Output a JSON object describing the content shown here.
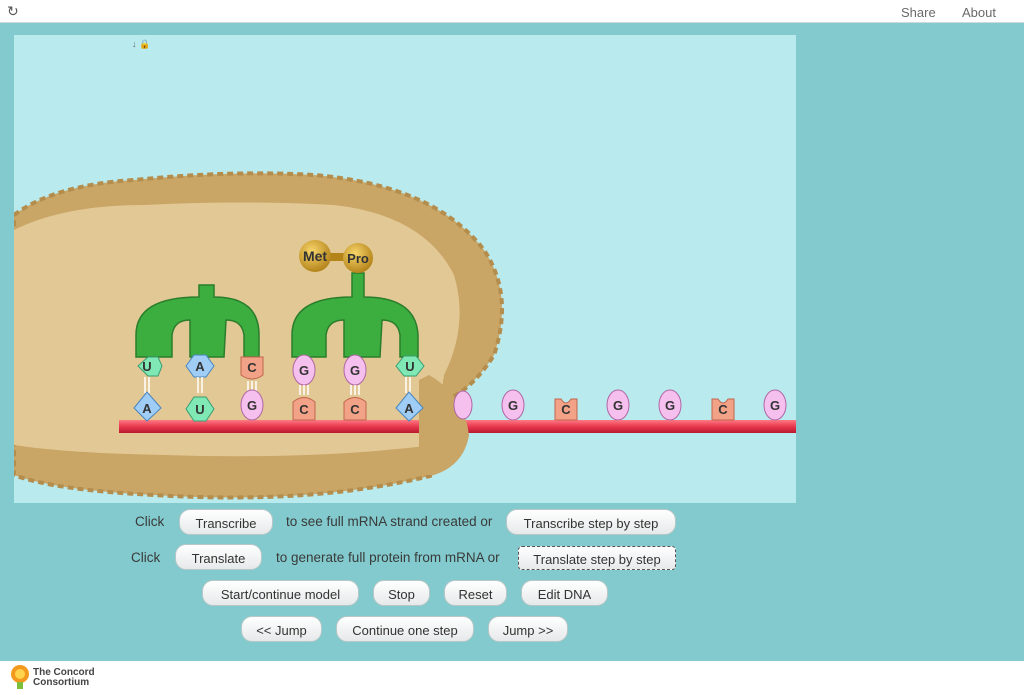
{
  "topbar": {
    "reload_icon": "reload-icon",
    "share_label": "Share",
    "about_label": "About"
  },
  "model": {
    "amino_acids": [
      "Met",
      "Pro"
    ],
    "trna_anticodons": [
      [
        "U",
        "A",
        "C"
      ],
      [
        "G",
        "G",
        "U"
      ]
    ],
    "mrna_codons_paired": [
      "A",
      "U",
      "G",
      "C",
      "C",
      "A"
    ],
    "mrna_free_bases": [
      "G",
      "C",
      "G",
      "G",
      "C",
      "G"
    ],
    "colors": {
      "background": "#b8eaee",
      "ribosome": "#d9bf88",
      "trna": "#3cae3f",
      "mrna_strand": "#e8384f",
      "base_A": "#9fcdf5",
      "base_U": "#7fe8b5",
      "base_G": "#f6c0ee",
      "base_C": "#f2a287"
    }
  },
  "controls": {
    "row1": {
      "prefix": "Click",
      "button": "Transcribe",
      "middle": "to see full mRNA strand created or",
      "step_button": "Transcribe step by step"
    },
    "row2": {
      "prefix": "Click",
      "button": "Translate",
      "middle": "to generate full protein from mRNA or",
      "step_button": "Translate step by step"
    },
    "row3": {
      "start": "Start/continue model",
      "stop": "Stop",
      "reset": "Reset",
      "edit": "Edit DNA"
    },
    "row4": {
      "jump_back": "<< Jump",
      "continue": "Continue one step",
      "jump_forward": "Jump >>"
    }
  },
  "footer": {
    "logo_line1": "The Concord",
    "logo_line2": "Consortium"
  }
}
